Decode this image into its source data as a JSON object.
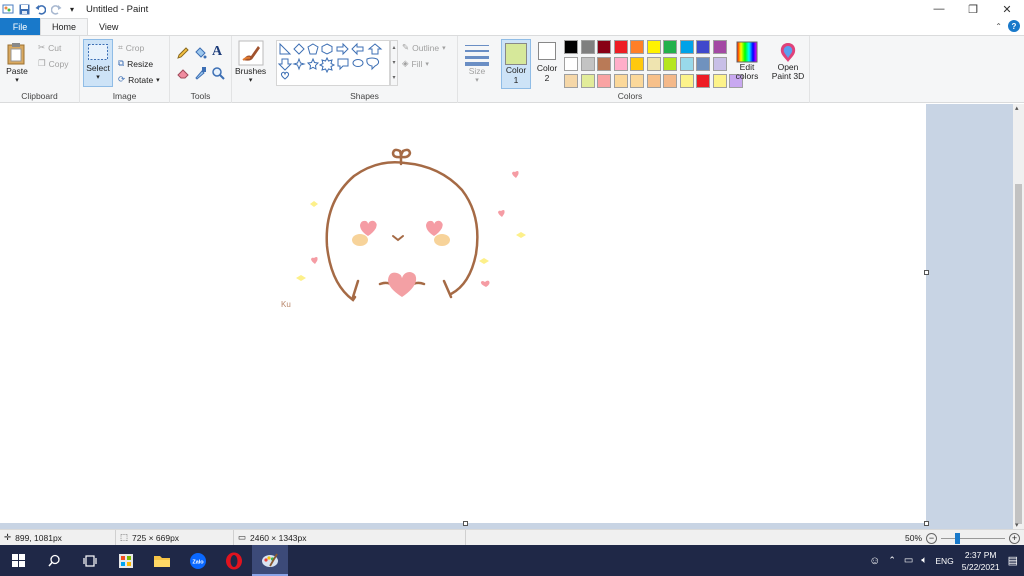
{
  "window": {
    "title": "Untitled - Paint",
    "controls": {
      "minimize": "—",
      "maximize": "❐",
      "close": "✕"
    }
  },
  "tabs": [
    {
      "label": "File"
    },
    {
      "label": "Home"
    },
    {
      "label": "View"
    }
  ],
  "ribbon": {
    "clipboard": {
      "label": "Clipboard",
      "paste": "Paste",
      "cut": "Cut",
      "copy": "Copy"
    },
    "image": {
      "label": "Image",
      "select": "Select",
      "crop": "Crop",
      "resize": "Resize",
      "rotate": "Rotate"
    },
    "tools": {
      "label": "Tools"
    },
    "brushes": {
      "label": "Brushes"
    },
    "shapes": {
      "label": "Shapes",
      "outline": "Outline",
      "fill": "Fill"
    },
    "size": {
      "label": "Size"
    },
    "color1": {
      "label": "Color",
      "sub": "1",
      "value": "#d6e89a"
    },
    "color2": {
      "label": "Color",
      "sub": "2",
      "value": "#ffffff"
    },
    "colors": {
      "label": "Colors",
      "row1": [
        "#000000",
        "#7f7f7f",
        "#880015",
        "#ed1c24",
        "#ff7f27",
        "#fff200",
        "#22b14c",
        "#00a2e8",
        "#3f48cc",
        "#a349a4"
      ],
      "row2": [
        "#ffffff",
        "#c3c3c3",
        "#b97a57",
        "#ffaec9",
        "#ffc90e",
        "#efe4b0",
        "#b5e61d",
        "#99d9ea",
        "#7092be",
        "#c8bfe7"
      ],
      "row3": [
        "#f5d7a8",
        "#e2ec9a",
        "#f9a3a3",
        "#fbd89a",
        "#fbd89a",
        "#f7c08a",
        "#f4b98a",
        "#fcf28a",
        "#ed1c24",
        "#fdf38a",
        "#c8a8f0"
      ]
    },
    "edit_colors": "Edit colors",
    "open_paint3d": "Open Paint 3D"
  },
  "canvas": {
    "signature": "Ku"
  },
  "status": {
    "cursor": "899, 1081px",
    "selection": "725 × 669px",
    "image_size": "2460 × 1343px",
    "zoom": "50%"
  },
  "taskbar": {
    "time": "2:37 PM",
    "date": "5/22/2021",
    "lang": "ENG"
  }
}
